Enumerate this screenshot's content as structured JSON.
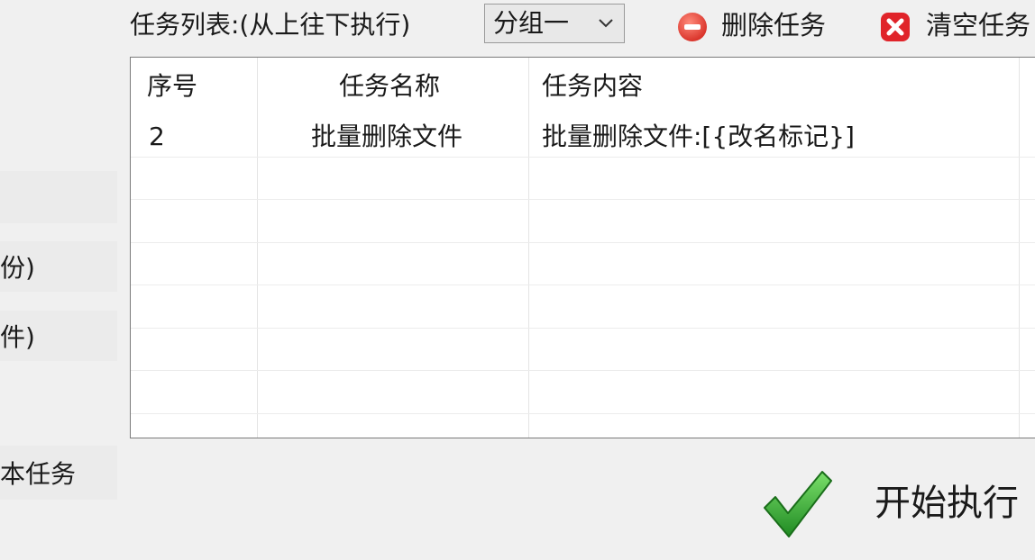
{
  "left_panel": {
    "item_a": "份)",
    "item_b": "件)",
    "item_c": "本任务"
  },
  "toolbar": {
    "task_list_label": "任务列表:(从上往下执行)",
    "group_select": {
      "value": "分组一"
    },
    "delete_task_label": "删除任务",
    "clear_tasks_label": "清空任务"
  },
  "table": {
    "columns": [
      "序号",
      "任务名称",
      "任务内容"
    ],
    "rows": [
      {
        "index": "2",
        "name": "批量删除文件",
        "content": "批量删除文件:[{改名标记}]"
      }
    ]
  },
  "start_button": {
    "label": "开始执行"
  },
  "colors": {
    "delete_icon": "#e8453c",
    "clear_icon": "#e0242a",
    "check_green": "#2e9b2e"
  }
}
